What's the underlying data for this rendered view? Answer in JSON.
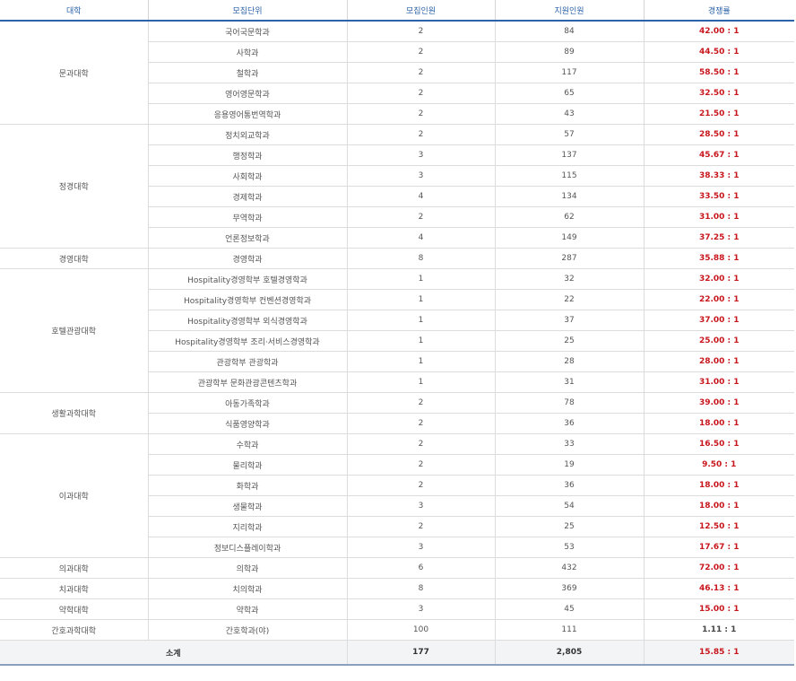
{
  "headers": [
    "대학",
    "모집단위",
    "모집인원",
    "지원인원",
    "경쟁률"
  ],
  "groups": [
    {
      "college": "문과대학",
      "rows": [
        {
          "unit": "국어국문학과",
          "quota": "2",
          "applicants": "84",
          "ratio": "42.00 : 1"
        },
        {
          "unit": "사학과",
          "quota": "2",
          "applicants": "89",
          "ratio": "44.50 : 1"
        },
        {
          "unit": "철학과",
          "quota": "2",
          "applicants": "117",
          "ratio": "58.50 : 1"
        },
        {
          "unit": "영어영문학과",
          "quota": "2",
          "applicants": "65",
          "ratio": "32.50 : 1"
        },
        {
          "unit": "응용영어통번역학과",
          "quota": "2",
          "applicants": "43",
          "ratio": "21.50 : 1"
        }
      ]
    },
    {
      "college": "정경대학",
      "rows": [
        {
          "unit": "정치외교학과",
          "quota": "2",
          "applicants": "57",
          "ratio": "28.50 : 1"
        },
        {
          "unit": "행정학과",
          "quota": "3",
          "applicants": "137",
          "ratio": "45.67 : 1"
        },
        {
          "unit": "사회학과",
          "quota": "3",
          "applicants": "115",
          "ratio": "38.33 : 1"
        },
        {
          "unit": "경제학과",
          "quota": "4",
          "applicants": "134",
          "ratio": "33.50 : 1"
        },
        {
          "unit": "무역학과",
          "quota": "2",
          "applicants": "62",
          "ratio": "31.00 : 1"
        },
        {
          "unit": "언론정보학과",
          "quota": "4",
          "applicants": "149",
          "ratio": "37.25 : 1"
        }
      ]
    },
    {
      "college": "경영대학",
      "rows": [
        {
          "unit": "경영학과",
          "quota": "8",
          "applicants": "287",
          "ratio": "35.88 : 1"
        }
      ]
    },
    {
      "college": "호텔관광대학",
      "rows": [
        {
          "unit": "Hospitality경영학부 호텔경영학과",
          "quota": "1",
          "applicants": "32",
          "ratio": "32.00 : 1"
        },
        {
          "unit": "Hospitality경영학부 컨벤션경영학과",
          "quota": "1",
          "applicants": "22",
          "ratio": "22.00 : 1"
        },
        {
          "unit": "Hospitality경영학부 외식경영학과",
          "quota": "1",
          "applicants": "37",
          "ratio": "37.00 : 1"
        },
        {
          "unit": "Hospitality경영학부 조리·서비스경영학과",
          "quota": "1",
          "applicants": "25",
          "ratio": "25.00 : 1"
        },
        {
          "unit": "관광학부 관광학과",
          "quota": "1",
          "applicants": "28",
          "ratio": "28.00 : 1"
        },
        {
          "unit": "관광학부 문화관광콘텐츠학과",
          "quota": "1",
          "applicants": "31",
          "ratio": "31.00 : 1"
        }
      ]
    },
    {
      "college": "생활과학대학",
      "rows": [
        {
          "unit": "아동가족학과",
          "quota": "2",
          "applicants": "78",
          "ratio": "39.00 : 1"
        },
        {
          "unit": "식품영양학과",
          "quota": "2",
          "applicants": "36",
          "ratio": "18.00 : 1"
        }
      ]
    },
    {
      "college": "이과대학",
      "rows": [
        {
          "unit": "수학과",
          "quota": "2",
          "applicants": "33",
          "ratio": "16.50 : 1"
        },
        {
          "unit": "물리학과",
          "quota": "2",
          "applicants": "19",
          "ratio": "9.50 : 1"
        },
        {
          "unit": "화학과",
          "quota": "2",
          "applicants": "36",
          "ratio": "18.00 : 1"
        },
        {
          "unit": "생물학과",
          "quota": "3",
          "applicants": "54",
          "ratio": "18.00 : 1"
        },
        {
          "unit": "지리학과",
          "quota": "2",
          "applicants": "25",
          "ratio": "12.50 : 1"
        },
        {
          "unit": "정보디스플레이학과",
          "quota": "3",
          "applicants": "53",
          "ratio": "17.67 : 1"
        }
      ]
    },
    {
      "college": "의과대학",
      "rows": [
        {
          "unit": "의학과",
          "quota": "6",
          "applicants": "432",
          "ratio": "72.00 : 1"
        }
      ]
    },
    {
      "college": "치과대학",
      "rows": [
        {
          "unit": "치의학과",
          "quota": "8",
          "applicants": "369",
          "ratio": "46.13 : 1"
        }
      ]
    },
    {
      "college": "약학대학",
      "rows": [
        {
          "unit": "약학과",
          "quota": "3",
          "applicants": "45",
          "ratio": "15.00 : 1"
        }
      ]
    },
    {
      "college": "간호과학대학",
      "rows": [
        {
          "unit": "간호학과(야)",
          "quota": "100",
          "applicants": "111",
          "ratio": "1.11 : 1",
          "plain": true
        }
      ]
    }
  ],
  "total": {
    "label": "소계",
    "quota": "177",
    "applicants": "2,805",
    "ratio": "15.85 : 1"
  },
  "colors": {
    "header_text": "#2c62a8",
    "ratio_text": "#c8161d"
  }
}
